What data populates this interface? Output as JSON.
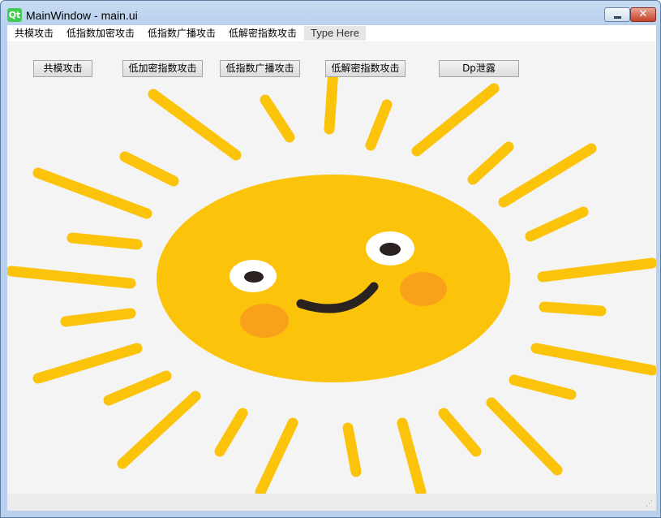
{
  "window": {
    "title": "MainWindow - main.ui",
    "logo_text": "Qt",
    "minimize_icon": "minimize-icon",
    "close_icon": "close-icon",
    "close_glyph": "✕"
  },
  "menubar": {
    "items": [
      "共模攻击",
      "低指数加密攻击",
      "低指数广播攻击",
      "低解密指数攻击"
    ],
    "type_here": "Type Here"
  },
  "buttons": [
    "共模攻击",
    "低加密指数攻击",
    "低指数广播攻击",
    "低解密指数攻击",
    "Dp泄露"
  ],
  "colors": {
    "sun": "#fcc30b",
    "cheek": "#f9a11b",
    "eye_white": "#ffffff",
    "pupil": "#2a2220",
    "smile": "#2a2220",
    "window_frame": "#b9d1ee",
    "client_bg": "#f4f4f4"
  },
  "background_image": "smiling-sun-illustration"
}
